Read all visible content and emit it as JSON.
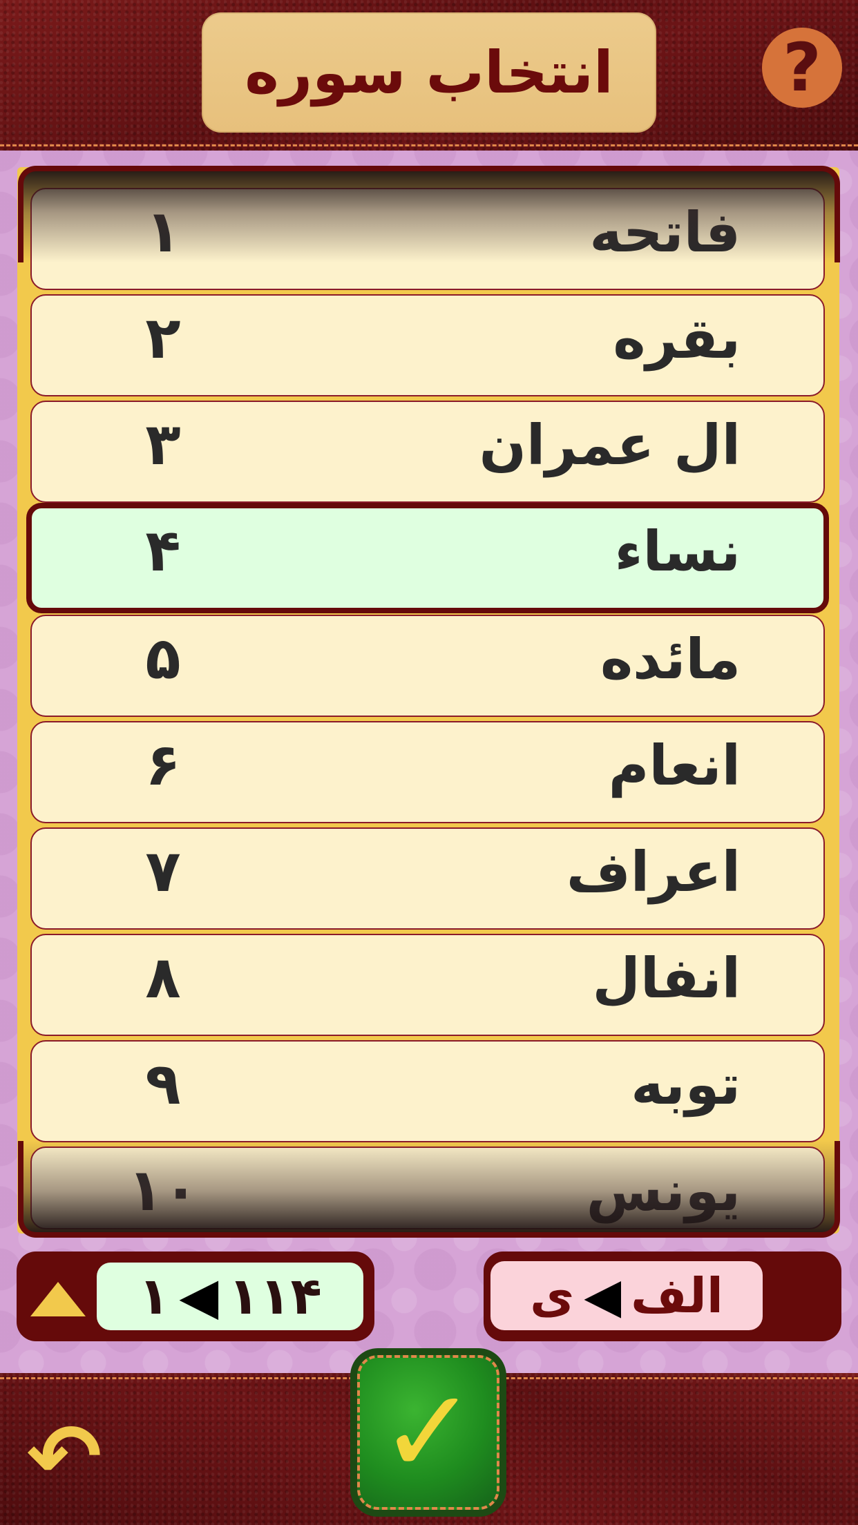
{
  "header": {
    "title": "انتخاب سوره",
    "help_label": "?"
  },
  "list": {
    "rows": [
      {
        "name": "فاتحه",
        "number": "۱"
      },
      {
        "name": "بقره",
        "number": "۲"
      },
      {
        "name": "ال عمران",
        "number": "۳"
      },
      {
        "name": "نساء",
        "number": "۴"
      },
      {
        "name": "مائده",
        "number": "۵"
      },
      {
        "name": "انعام",
        "number": "۶"
      },
      {
        "name": "اعراف",
        "number": "۷"
      },
      {
        "name": "انفال",
        "number": "۸"
      },
      {
        "name": "توبه",
        "number": "۹"
      },
      {
        "name": "یونس",
        "number": "۱۰"
      }
    ],
    "selected_index": 3
  },
  "sort_controls": {
    "numeric_from": "۱",
    "numeric_to": "۱۱۴",
    "alpha_from": "الف",
    "alpha_to": "ی"
  },
  "footer": {
    "confirm_glyph": "✓",
    "back_glyph": "↶"
  },
  "colors": {
    "leather": "#5a0e10",
    "background": "#d6a4d6",
    "row": "#fdf2cc",
    "selected_row": "#dfffe0",
    "accent": "#f2c94c",
    "confirm": "#1f8d1f"
  }
}
